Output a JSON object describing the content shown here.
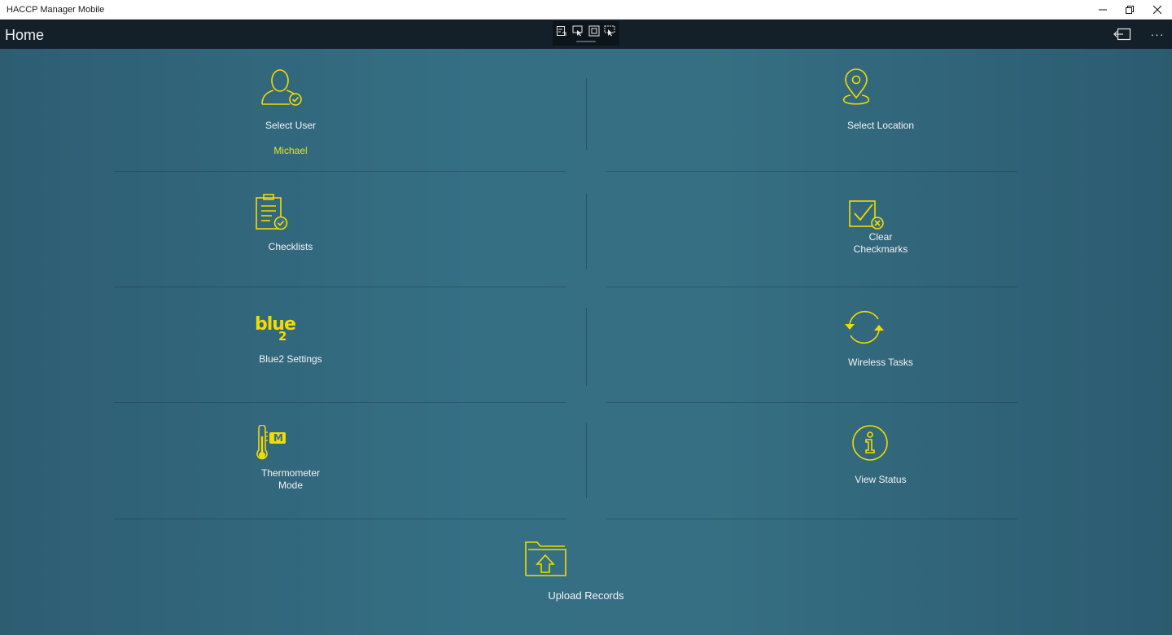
{
  "window": {
    "title": "HACCP Manager Mobile"
  },
  "header": {
    "page_title": "Home",
    "more_label": "···"
  },
  "colors": {
    "accent": "#f2dc00",
    "header_bg": "#142029",
    "tile_bg": "#356f84",
    "text": "#f4f4f4",
    "selected_user": "#e3e81c"
  },
  "tiles": {
    "select_user": {
      "label": "Select User",
      "value": "Michael",
      "icon": "user-check-icon"
    },
    "select_location": {
      "label": "Select Location",
      "icon": "location-pin-icon"
    },
    "checklists": {
      "label": "Checklists",
      "icon": "clipboard-check-icon"
    },
    "clear_checkmarks": {
      "label_line1": "Clear",
      "label_line2": "Checkmarks",
      "icon": "checkbox-clear-icon"
    },
    "blue2_settings": {
      "label": "Blue2 Settings",
      "logo_text": "blue",
      "logo_sub": "2",
      "icon": "blue2-logo"
    },
    "wireless_tasks": {
      "label": "Wireless Tasks",
      "icon": "sync-icon"
    },
    "thermometer_mode": {
      "label_line1": "Thermometer",
      "label_line2": "Mode",
      "badge": "M",
      "icon": "thermometer-icon"
    },
    "view_status": {
      "label": "View Status",
      "icon": "info-icon"
    },
    "upload_records": {
      "label": "Upload Records",
      "icon": "folder-upload-icon"
    }
  }
}
